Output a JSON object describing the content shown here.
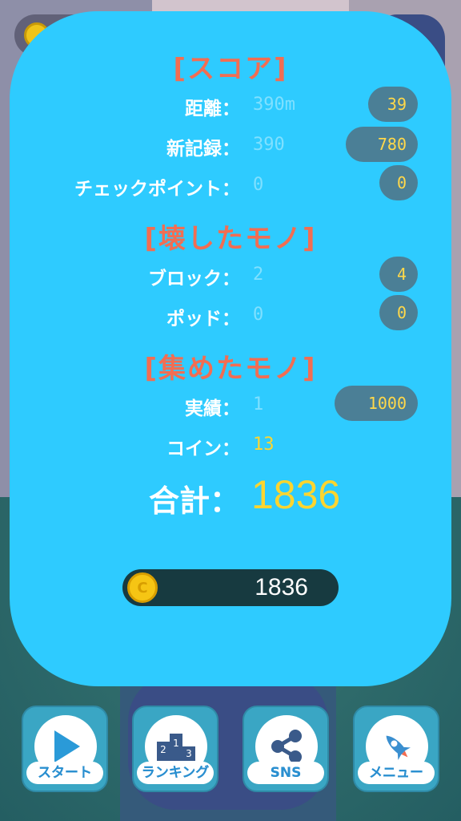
{
  "hud": {
    "coin_icon": "coin-icon"
  },
  "score_section": {
    "title": "[スコア]",
    "rows": [
      {
        "label": "距離：",
        "value": "390m",
        "points": "39"
      },
      {
        "label": "新記録：",
        "value": "390",
        "points": "780"
      },
      {
        "label": "チェックポイント：",
        "value": "0",
        "points": "0"
      }
    ]
  },
  "broken_section": {
    "title": "[壊したモノ]",
    "rows": [
      {
        "label": "ブロック：",
        "value": "2",
        "points": "4"
      },
      {
        "label": "ポッド：",
        "value": "0",
        "points": "0"
      }
    ]
  },
  "collected_section": {
    "title": "[集めたモノ]",
    "rows": [
      {
        "label": "実績：",
        "value": "1",
        "points": "1000"
      },
      {
        "label": "コイン：",
        "value": "13"
      }
    ]
  },
  "total": {
    "label": "合計：",
    "value": "1836"
  },
  "coin_balance": {
    "coin_symbol": "C",
    "value": "1836"
  },
  "buttons": [
    {
      "label": "スタート",
      "icon": "play-icon"
    },
    {
      "label": "ランキング",
      "icon": "podium-icon"
    },
    {
      "label": "SNS",
      "icon": "share-icon"
    },
    {
      "label": "メニュー",
      "icon": "rocket-icon"
    }
  ],
  "colors": {
    "panel": "#2ecbff",
    "title": "#f26d52",
    "accent": "#ffd52e"
  }
}
